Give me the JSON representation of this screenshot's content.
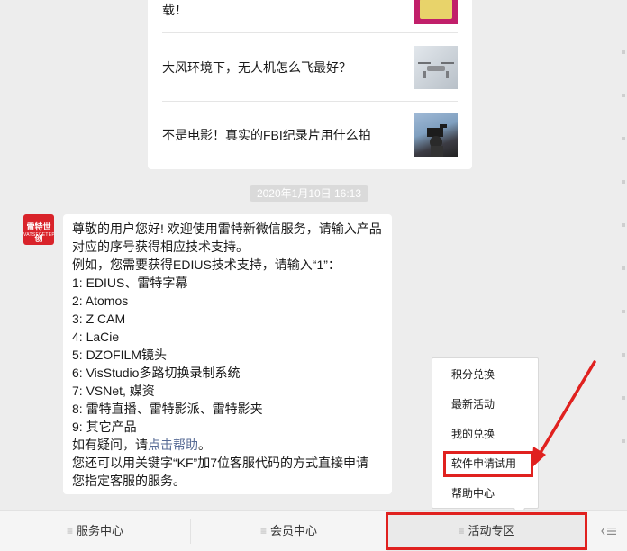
{
  "articles": [
    {
      "title": "载！",
      "thumb": "promo-thumbnail"
    },
    {
      "title": "大风环境下，无人机怎么飞最好？",
      "thumb": "drone-thumbnail"
    },
    {
      "title": "不是电影！真实的FBI纪录片用什么拍",
      "thumb": "camera-operator-thumbnail"
    }
  ],
  "timestamp": "2020年1月10日 16:13",
  "avatar": {
    "brand": "雷特世创",
    "sub": "VATSFCETEP"
  },
  "message": {
    "lines": [
      "尊敬的用户您好! 欢迎使用雷特新微信服务，请输入产品",
      "对应的序号获得相应技术支持。",
      "例如，您需要获得EDIUS技术支持，请输入“1”：",
      "1: EDIUS、雷特字幕",
      "2: Atomos",
      "3: Z CAM",
      "4: LaCie",
      "5: DZOFILM镜头",
      "6: VisStudio多路切换录制系统",
      "7: VSNet, 媒资",
      "8: 雷特直播、雷特影派、雷特影夹",
      "9: 其它产品"
    ],
    "help_prefix": "如有疑问，请",
    "help_link": "点击帮助",
    "help_suffix": "。",
    "tail_lines": [
      "您还可以用关键字“KF”加7位客服代码的方式直接申请",
      "您指定客服的服务。"
    ]
  },
  "popup": {
    "items": [
      "积分兑换",
      "最新活动",
      "我的兑换",
      "软件申请试用",
      "帮助中心"
    ]
  },
  "menu": {
    "items": [
      "服务中心",
      "会员中心",
      "活动专区"
    ],
    "lines_icon": "≡",
    "keyboard_icon": "keyboard-toggle-icon"
  },
  "colors": {
    "background": "#ededed",
    "annotation_red": "#e0211f",
    "link": "#576b95",
    "brand_red": "#d9232a"
  }
}
